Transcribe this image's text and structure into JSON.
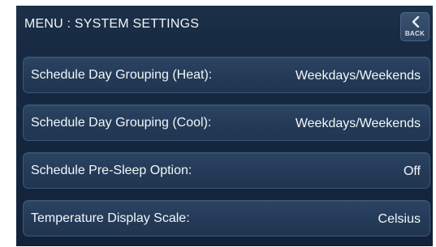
{
  "header": {
    "title": "MENU : SYSTEM SETTINGS",
    "back_label": "BACK"
  },
  "settings": [
    {
      "label": "Schedule Day Grouping (Heat):",
      "value": "Weekdays/Weekends"
    },
    {
      "label": "Schedule Day Grouping (Cool):",
      "value": "Weekdays/Weekends"
    },
    {
      "label": "Schedule Pre-Sleep Option:",
      "value": "Off"
    },
    {
      "label": "Temperature Display Scale:",
      "value": "Celsius"
    }
  ],
  "icons": {
    "back": "chevron-left-icon"
  },
  "colors": {
    "background": "#152740",
    "row": "#2b4462",
    "row_border": "#3d5878",
    "text": "#f3f6f9"
  }
}
